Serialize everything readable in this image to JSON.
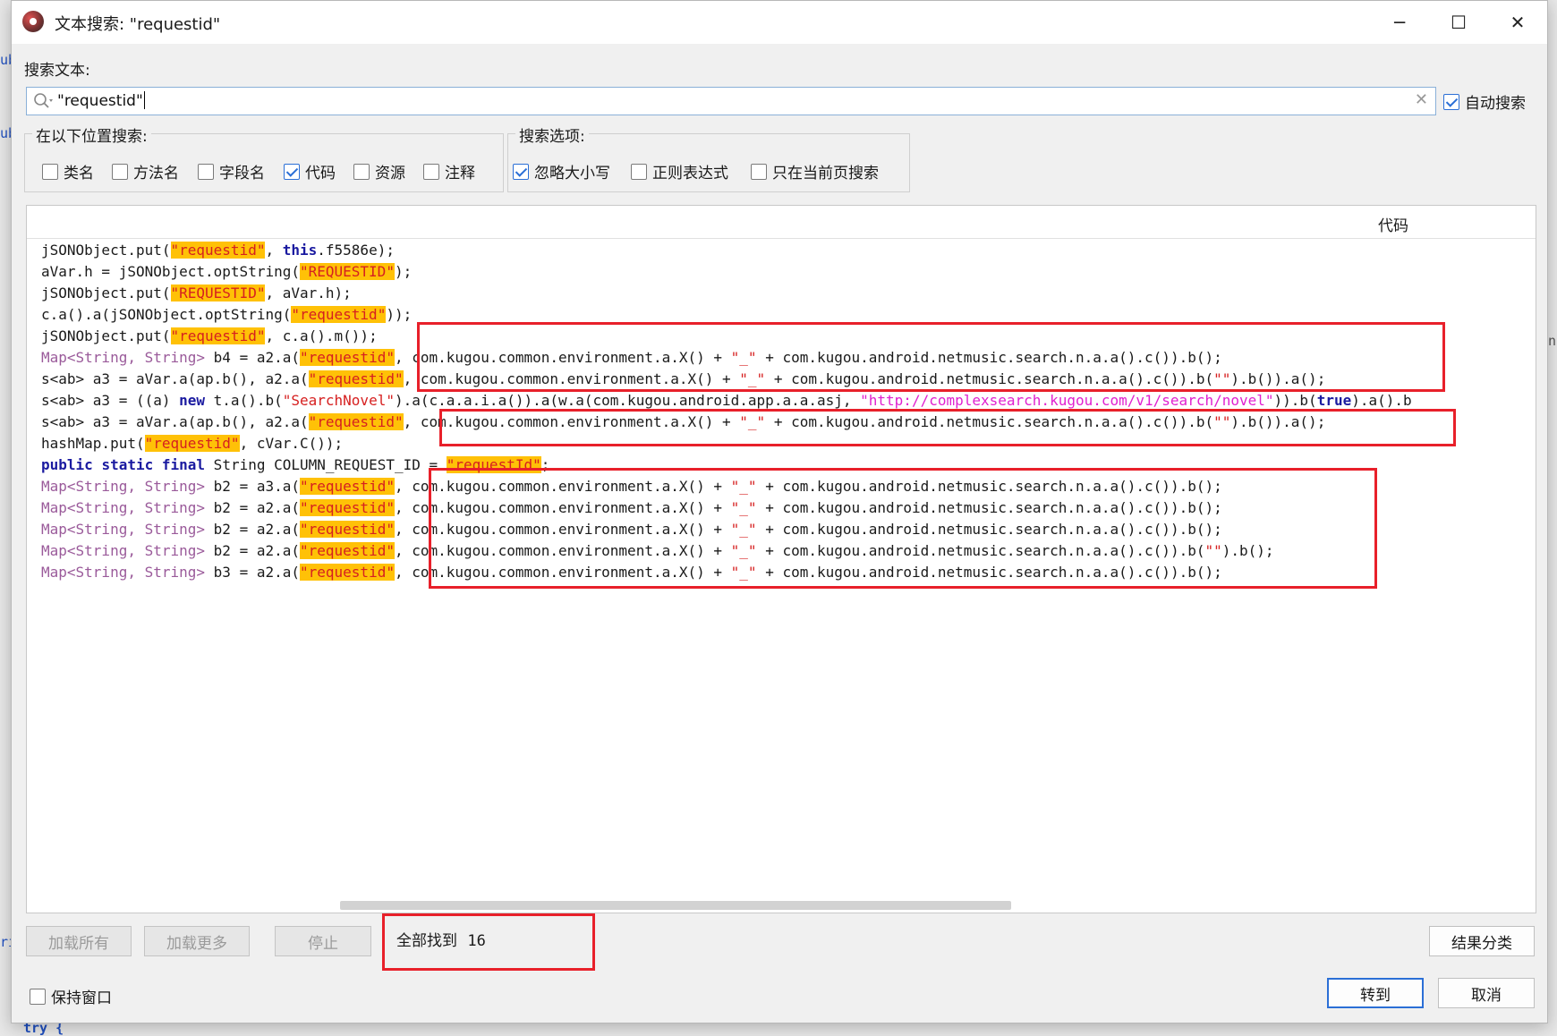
{
  "window": {
    "title": "文本搜索: \"requestid\"",
    "minimize_glyph": "─",
    "maximize_glyph": "☐",
    "close_glyph": "✕"
  },
  "search": {
    "label": "搜索文本:",
    "value": "\"requestid\"",
    "auto_search": {
      "label": "自动搜索",
      "checked": true
    }
  },
  "scope": {
    "title": "在以下位置搜索:",
    "options": [
      {
        "label": "类名",
        "checked": false
      },
      {
        "label": "方法名",
        "checked": false
      },
      {
        "label": "字段名",
        "checked": false
      },
      {
        "label": "代码",
        "checked": true
      },
      {
        "label": "资源",
        "checked": false
      },
      {
        "label": "注释",
        "checked": false
      }
    ]
  },
  "search_options": {
    "title": "搜索选项:",
    "options": [
      {
        "label": "忽略大小写",
        "checked": true
      },
      {
        "label": "正则表达式",
        "checked": false
      },
      {
        "label": "只在当前页搜索",
        "checked": false
      }
    ]
  },
  "results": {
    "column_header": "代码",
    "lines": [
      "jSONObject.put(\"requestid\", this.f5586e);",
      "aVar.h = jSONObject.optString(\"REQUESTID\");",
      "jSONObject.put(\"REQUESTID\", aVar.h);",
      "c.a().a(jSONObject.optString(\"requestid\"));",
      "jSONObject.put(\"requestid\", c.a().m());",
      "Map<String, String> b4 = a2.a(\"requestid\", com.kugou.common.environment.a.X() + \"_\" + com.kugou.android.netmusic.search.n.a.a().c()).b();",
      "s<ab> a3 = aVar.a(ap.b(), a2.a(\"requestid\", com.kugou.common.environment.a.X() + \"_\" + com.kugou.android.netmusic.search.n.a.a().c()).b(\"\").b()).a();",
      "s<ab> a3 = ((a) new t.a().b(\"SearchNovel\").a(c.a.a.i.a()).a(w.a(com.kugou.android.app.a.a.asj, \"http://complexsearch.kugou.com/v1/search/novel\")).b(true).a().b",
      "s<ab> a3 = aVar.a(ap.b(), a2.a(\"requestid\", com.kugou.common.environment.a.X() + \"_\" + com.kugou.android.netmusic.search.n.a.a().c()).b(\"\").b()).a();",
      "hashMap.put(\"requestid\", cVar.C());",
      "public static final String COLUMN_REQUEST_ID = \"requestId\";",
      "Map<String, String> b2 = a3.a(\"requestid\", com.kugou.common.environment.a.X() + \"_\" + com.kugou.android.netmusic.search.n.a.a().c()).b();",
      "Map<String, String> b2 = a2.a(\"requestid\", com.kugou.common.environment.a.X() + \"_\" + com.kugou.android.netmusic.search.n.a.a().c()).b();",
      "Map<String, String> b2 = a2.a(\"requestid\", com.kugou.common.environment.a.X() + \"_\" + com.kugou.android.netmusic.search.n.a.a().c()).b();",
      "Map<String, String> b2 = a2.a(\"requestid\", com.kugou.common.environment.a.X() + \"_\" + com.kugou.android.netmusic.search.n.a.a().c()).b(\"\").b();",
      "Map<String, String> b3 = a2.a(\"requestid\", com.kugou.common.environment.a.X() + \"_\" + com.kugou.android.netmusic.search.n.a.a().c()).b();"
    ]
  },
  "footer": {
    "load_all": "加载所有",
    "load_more": "加载更多",
    "stop": "停止",
    "found_label": "全部找到",
    "found_count": "16",
    "group_results": "结果分类",
    "keep_window": {
      "label": "保持窗口",
      "checked": false
    },
    "goto": "转到",
    "cancel": "取消"
  },
  "background_editor": {
    "fragments": [
      "ub",
      "ub",
      "ri",
      "try {",
      "n"
    ]
  },
  "colors": {
    "highlight": "#ffc107",
    "string": "#d62020",
    "keyword": "#1a1aa0",
    "annotation_box": "#e8202a",
    "accent": "#2b6fd6"
  }
}
